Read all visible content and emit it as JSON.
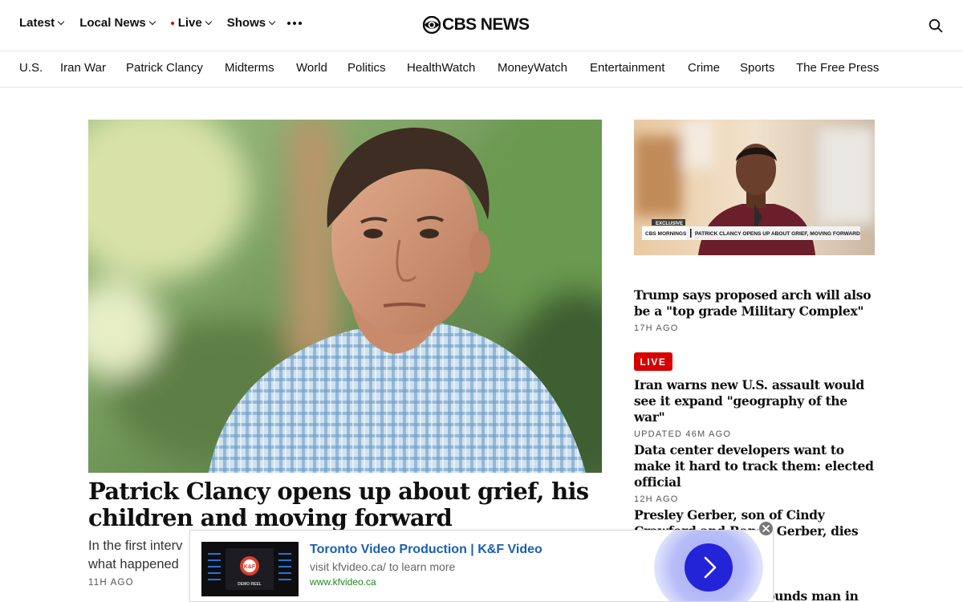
{
  "header": {
    "nav": [
      {
        "label": "Latest",
        "dropdown": true
      },
      {
        "label": "Local News",
        "dropdown": true
      },
      {
        "label": "Live",
        "dropdown": true,
        "live_dot": true
      },
      {
        "label": "Shows",
        "dropdown": true
      }
    ],
    "more_icon": "more-dots-icon",
    "logo_text": "CBS NEWS",
    "search_icon": "search-icon"
  },
  "section_nav": [
    "U.S.",
    "Iran War",
    "Patrick Clancy",
    "Midterms",
    "World",
    "Politics",
    "HealthWatch",
    "MoneyWatch",
    "Entertainment",
    "Crime",
    "Sports",
    "The Free Press"
  ],
  "hero": {
    "title": "Patrick Clancy opens up about grief, his children and moving forward",
    "dek_line1": "In the first interv",
    "dek_line2": "what happened",
    "time": "11H AGO"
  },
  "side_video": {
    "exclusive_label": "EXCLUSIVE",
    "chyron_brand": "CBS MORNINGS",
    "chyron_text": "PATRICK CLANCY OPENS UP ABOUT GRIEF, MOVING FORWARD"
  },
  "side_stories": [
    {
      "title": "Trump says proposed arch will also be a \"top grade Military Complex\"",
      "time": "17H AGO"
    },
    {
      "badge": "LIVE",
      "title": "Iran warns new U.S. assault would see it expand \"geography of the war\"",
      "time": "UPDATED 46M AGO"
    },
    {
      "title": "Data center developers want to make it hard to track them: elected official",
      "time": "12H AGO"
    },
    {
      "title_line1": "Presley Gerber, son of Cindy",
      "title_line2": "Crawford and Rande Gerber, dies at"
    },
    {
      "title_partial": "wounds man in"
    }
  ],
  "ad": {
    "title": "Toronto Video Production | K&F Video",
    "line": "visit kfvideo.ca/ to learn more",
    "url": "www.kfvideo.ca",
    "thumb_logo": "K&F",
    "thumb_caption": "DEMO REEL",
    "arrow_icon": "chevron-right-icon",
    "close_icon": "close-icon",
    "colors": {
      "title": "#1a5fb4",
      "url": "#1e8a1e",
      "button": "#2323d8"
    }
  },
  "colors": {
    "live_red": "#d60000",
    "text": "#101010"
  }
}
